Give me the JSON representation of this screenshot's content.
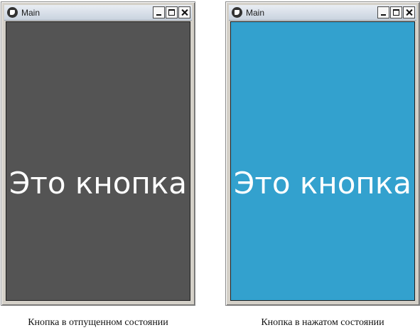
{
  "windows": [
    {
      "title": "Main",
      "button_text": "Это кнопка",
      "button_bg": "#545454",
      "caption": "Кнопка в отпущенном состоянии"
    },
    {
      "title": "Main",
      "button_text": "Это кнопка",
      "button_bg": "#33a1ce",
      "caption": "Кнопка в нажатом состоянии"
    }
  ],
  "icons": {
    "app": "app-logo-icon",
    "minimize": "minimize-icon",
    "maximize": "maximize-icon",
    "close": "close-icon"
  },
  "colors": {
    "button_text": "#ffffff"
  }
}
